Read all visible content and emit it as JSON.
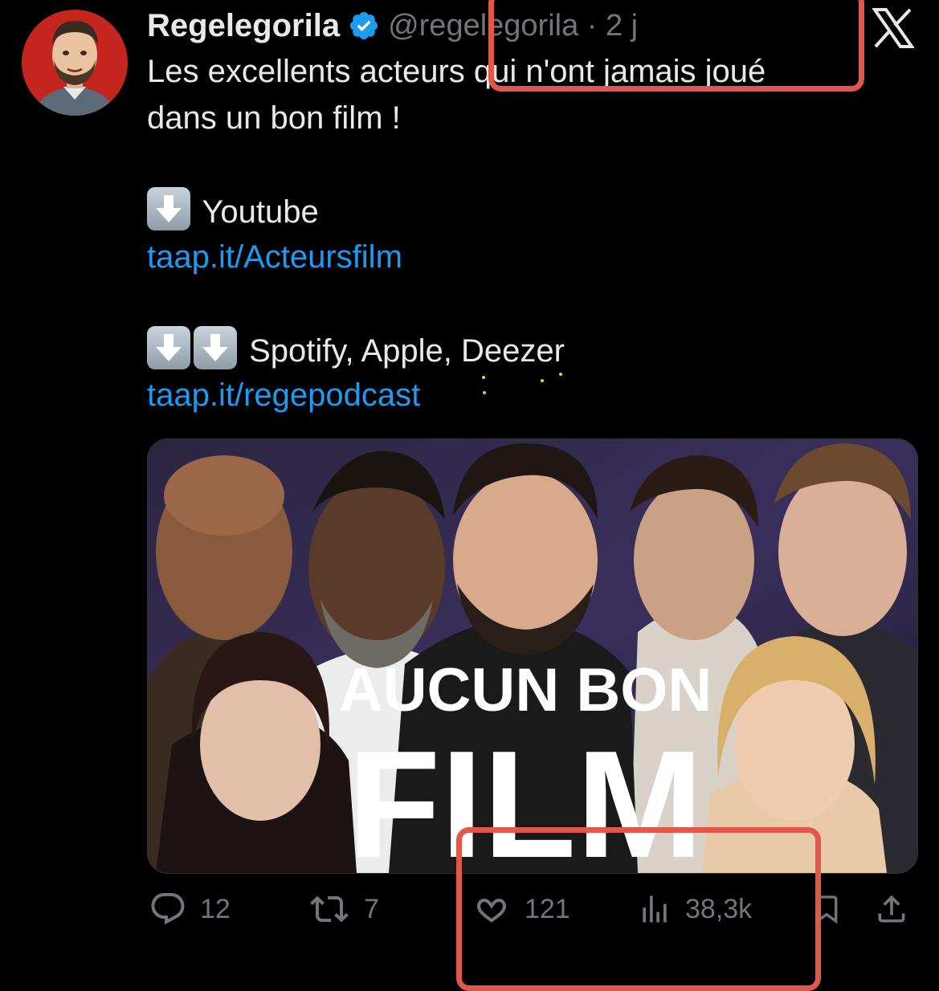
{
  "tweet": {
    "author_name": "Regelegorila",
    "handle_time": "@regelegorila · 2 j",
    "text_line1": "Les excellents acteurs qui n'ont jamais joué",
    "text_line2": "dans un bon film !",
    "youtube_label": "Youtube",
    "youtube_link": "taap.it/Acteursfilm",
    "podcast_label": "Spotify, Apple, Deezer",
    "podcast_link": "taap.it/regepodcast"
  },
  "thumbnail": {
    "title_line1": "AUCUN BON",
    "title_line2": "FILM"
  },
  "actions": {
    "replies": "12",
    "reposts": "7",
    "likes": "121",
    "views": "38,3k"
  },
  "icons": [
    "verified-badge-icon",
    "x-logo-icon",
    "down-arrow-emoji-icon",
    "reply-icon",
    "repost-icon",
    "like-icon",
    "views-icon",
    "bookmark-icon",
    "share-icon"
  ],
  "colors": {
    "background": "#000000",
    "text": "#e7e9ea",
    "muted": "#71767b",
    "link": "#1d9bf0",
    "verified": "#1d9bf0",
    "highlight_box": "#e2574c"
  }
}
